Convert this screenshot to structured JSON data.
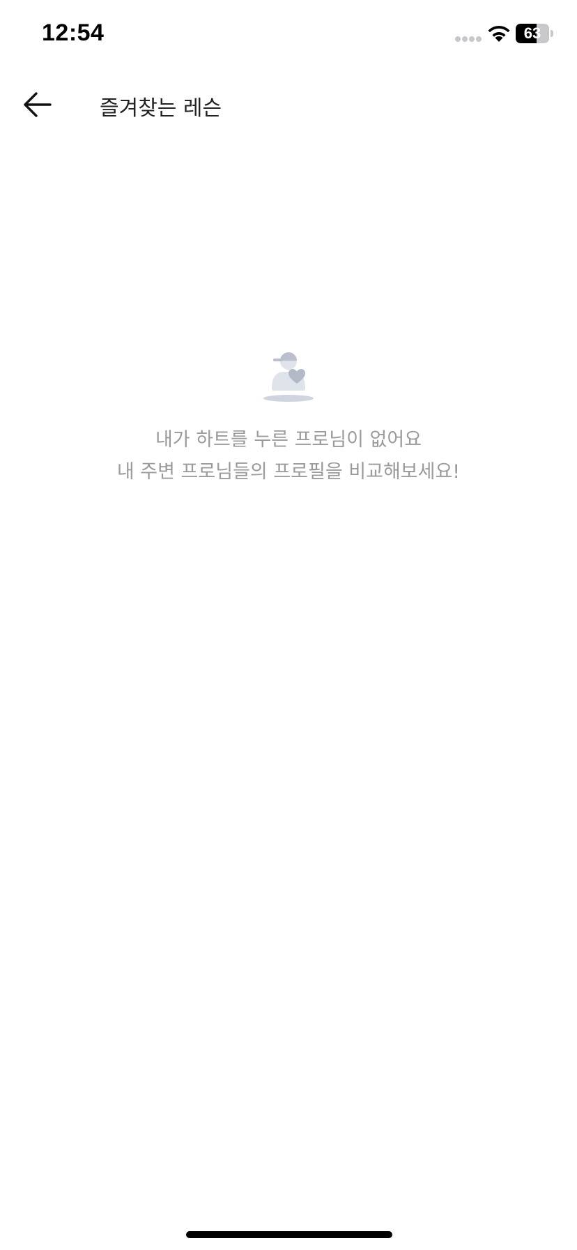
{
  "status_bar": {
    "time": "12:54",
    "battery_level": "63",
    "battery_percent": 63,
    "icons": [
      "signal-icon",
      "wifi-icon",
      "battery-icon"
    ]
  },
  "header": {
    "back_icon": "arrow-left-icon",
    "title": "즐겨찾는 레슨"
  },
  "empty_state": {
    "illustration_icon": "favorite-pro-empty-icon",
    "line1": "내가 하트를 누른 프로님이 없어요",
    "line2": "내 주변 프로님들의 프로필을 비교해보세요!"
  },
  "colors": {
    "text_primary": "#222222",
    "text_secondary": "#9a9a9a",
    "illustration": "#c5cad6",
    "background": "#ffffff"
  }
}
